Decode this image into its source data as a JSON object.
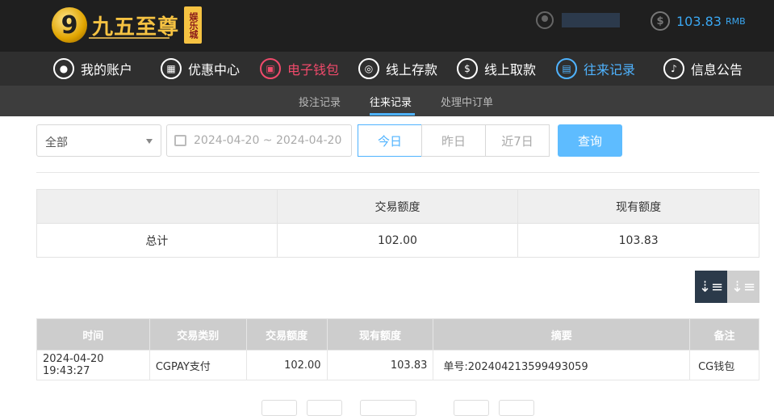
{
  "header": {
    "logo_number": "9",
    "logo_title": "九五至尊",
    "logo_badge": "娱乐城",
    "balance": "103.83",
    "currency": "RMB"
  },
  "nav": {
    "items": [
      {
        "label": "我的账户",
        "icon": "user-icon"
      },
      {
        "label": "优惠中心",
        "icon": "gift-icon"
      },
      {
        "label": "电子钱包",
        "icon": "wallet-icon"
      },
      {
        "label": "线上存款",
        "icon": "deposit-icon"
      },
      {
        "label": "线上取款",
        "icon": "withdraw-icon"
      },
      {
        "label": "往来记录",
        "icon": "records-icon"
      },
      {
        "label": "信息公告",
        "icon": "bell-icon"
      }
    ]
  },
  "subnav": {
    "items": [
      "投注记录",
      "往来记录",
      "处理中订单"
    ]
  },
  "filter": {
    "type_value": "全部",
    "date_range": "2024-04-20 ~ 2024-04-20",
    "today": "今日",
    "yesterday": "昨日",
    "last7": "近7日",
    "query": "查询"
  },
  "summary": {
    "headers": [
      "",
      "交易额度",
      "现有额度"
    ],
    "row": [
      "总计",
      "102.00",
      "103.83"
    ]
  },
  "table": {
    "headers": [
      "时间",
      "交易类别",
      "交易额度",
      "现有额度",
      "摘要",
      "备注"
    ],
    "rows": [
      [
        "2024-04-20 19:43:27",
        "CGPAY支付",
        "102.00",
        "103.83",
        "单号:202404213599493059",
        "CG钱包"
      ]
    ]
  },
  "colors": {
    "accent_blue": "#4fb3ff",
    "accent_red": "#f04a6b",
    "header_bg": "#1f1f1f"
  }
}
